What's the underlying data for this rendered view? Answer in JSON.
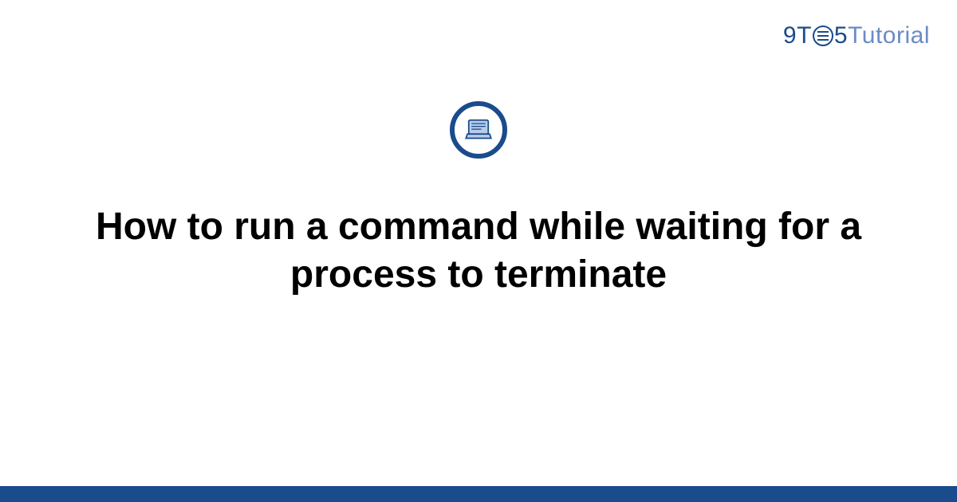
{
  "brand": {
    "part1": "9",
    "part2": "T",
    "part3": "5",
    "part4": "Tutorial"
  },
  "icon": {
    "name": "laptop-icon"
  },
  "title": "How to run a command while waiting for a process to terminate",
  "colors": {
    "primary": "#1a4b8c",
    "secondary": "#6b8bc4",
    "iconFill": "#b8cce8"
  }
}
